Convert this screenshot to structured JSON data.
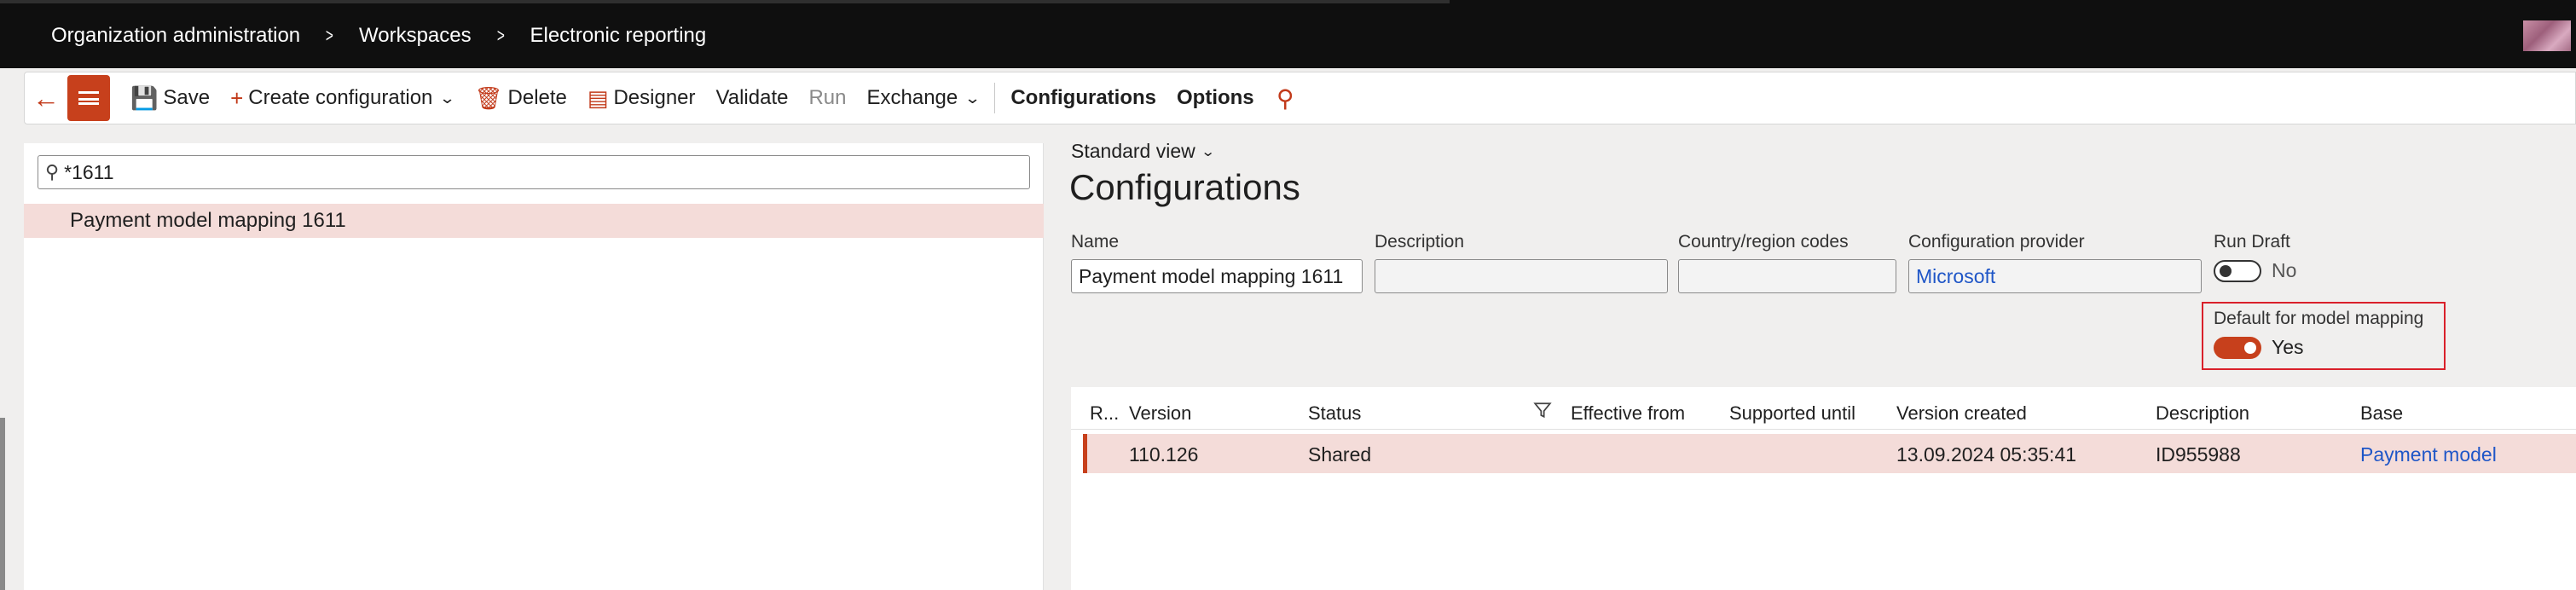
{
  "breadcrumb": {
    "items": [
      "Organization administration",
      "Workspaces",
      "Electronic reporting"
    ]
  },
  "toolbar": {
    "save": "Save",
    "create_configuration": "Create configuration",
    "delete": "Delete",
    "designer": "Designer",
    "validate": "Validate",
    "run": "Run",
    "exchange": "Exchange",
    "configurations": "Configurations",
    "options": "Options"
  },
  "tree": {
    "filter_value": "*1611",
    "items": [
      "Payment model mapping 1611"
    ]
  },
  "details": {
    "view": "Standard view",
    "title": "Configurations",
    "fields": {
      "name_label": "Name",
      "name_value": "Payment model mapping 1611",
      "description_label": "Description",
      "description_value": "",
      "country_label": "Country/region codes",
      "country_value": "",
      "provider_label": "Configuration provider",
      "provider_value": "Microsoft",
      "run_draft_label": "Run Draft",
      "run_draft_value": "No",
      "default_mapping_label": "Default for model mapping",
      "default_mapping_value": "Yes"
    }
  },
  "versions": {
    "columns": [
      "R...",
      "Version",
      "Status",
      "Effective from",
      "Supported until",
      "Version created",
      "Description",
      "Base"
    ],
    "rows": [
      {
        "version": "110.126",
        "status": "Shared",
        "effective_from": "",
        "supported_until": "",
        "created": "13.09.2024 05:35:41",
        "description": "ID955988",
        "base": "Payment model"
      }
    ]
  },
  "colors": {
    "accent": "#c7401c",
    "selected_row": "#f4dcd9",
    "link": "#1f56c7",
    "highlight": "#d9202a"
  }
}
